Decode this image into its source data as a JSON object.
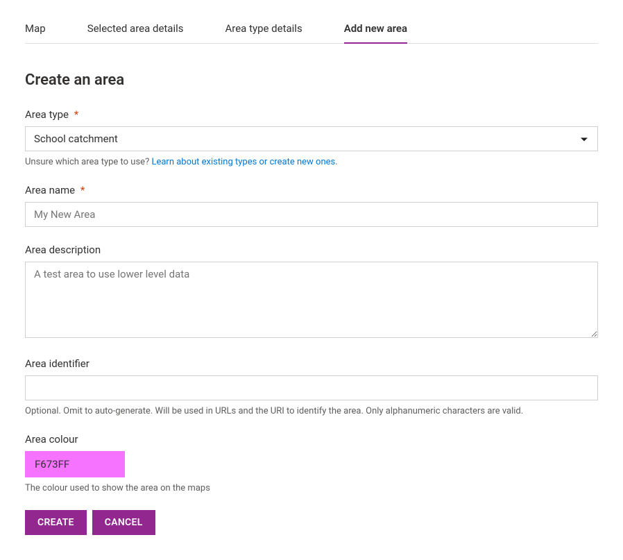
{
  "tabs": [
    {
      "label": "Map",
      "active": false
    },
    {
      "label": "Selected area details",
      "active": false
    },
    {
      "label": "Area type details",
      "active": false
    },
    {
      "label": "Add new area",
      "active": true
    }
  ],
  "page_title": "Create an area",
  "form": {
    "area_type": {
      "label": "Area type",
      "required": true,
      "value": "School catchment",
      "helper_prefix": "Unsure which area type to use? ",
      "helper_link": "Learn about existing types or create new ones",
      "helper_suffix": "."
    },
    "area_name": {
      "label": "Area name",
      "required": true,
      "placeholder": "My New Area",
      "value": ""
    },
    "area_description": {
      "label": "Area description",
      "placeholder": "A test area to use lower level data",
      "value": ""
    },
    "area_identifier": {
      "label": "Area identifier",
      "value": "",
      "helper": "Optional. Omit to auto-generate. Will be used in URLs and the URI to identify the area. Only alphanumeric characters are valid."
    },
    "area_colour": {
      "label": "Area colour",
      "value": "F673FF",
      "swatch": "#F673FF",
      "helper": "The colour used to show the area on the maps"
    }
  },
  "buttons": {
    "create": "CREATE",
    "cancel": "CANCEL"
  },
  "asterisk": "*"
}
